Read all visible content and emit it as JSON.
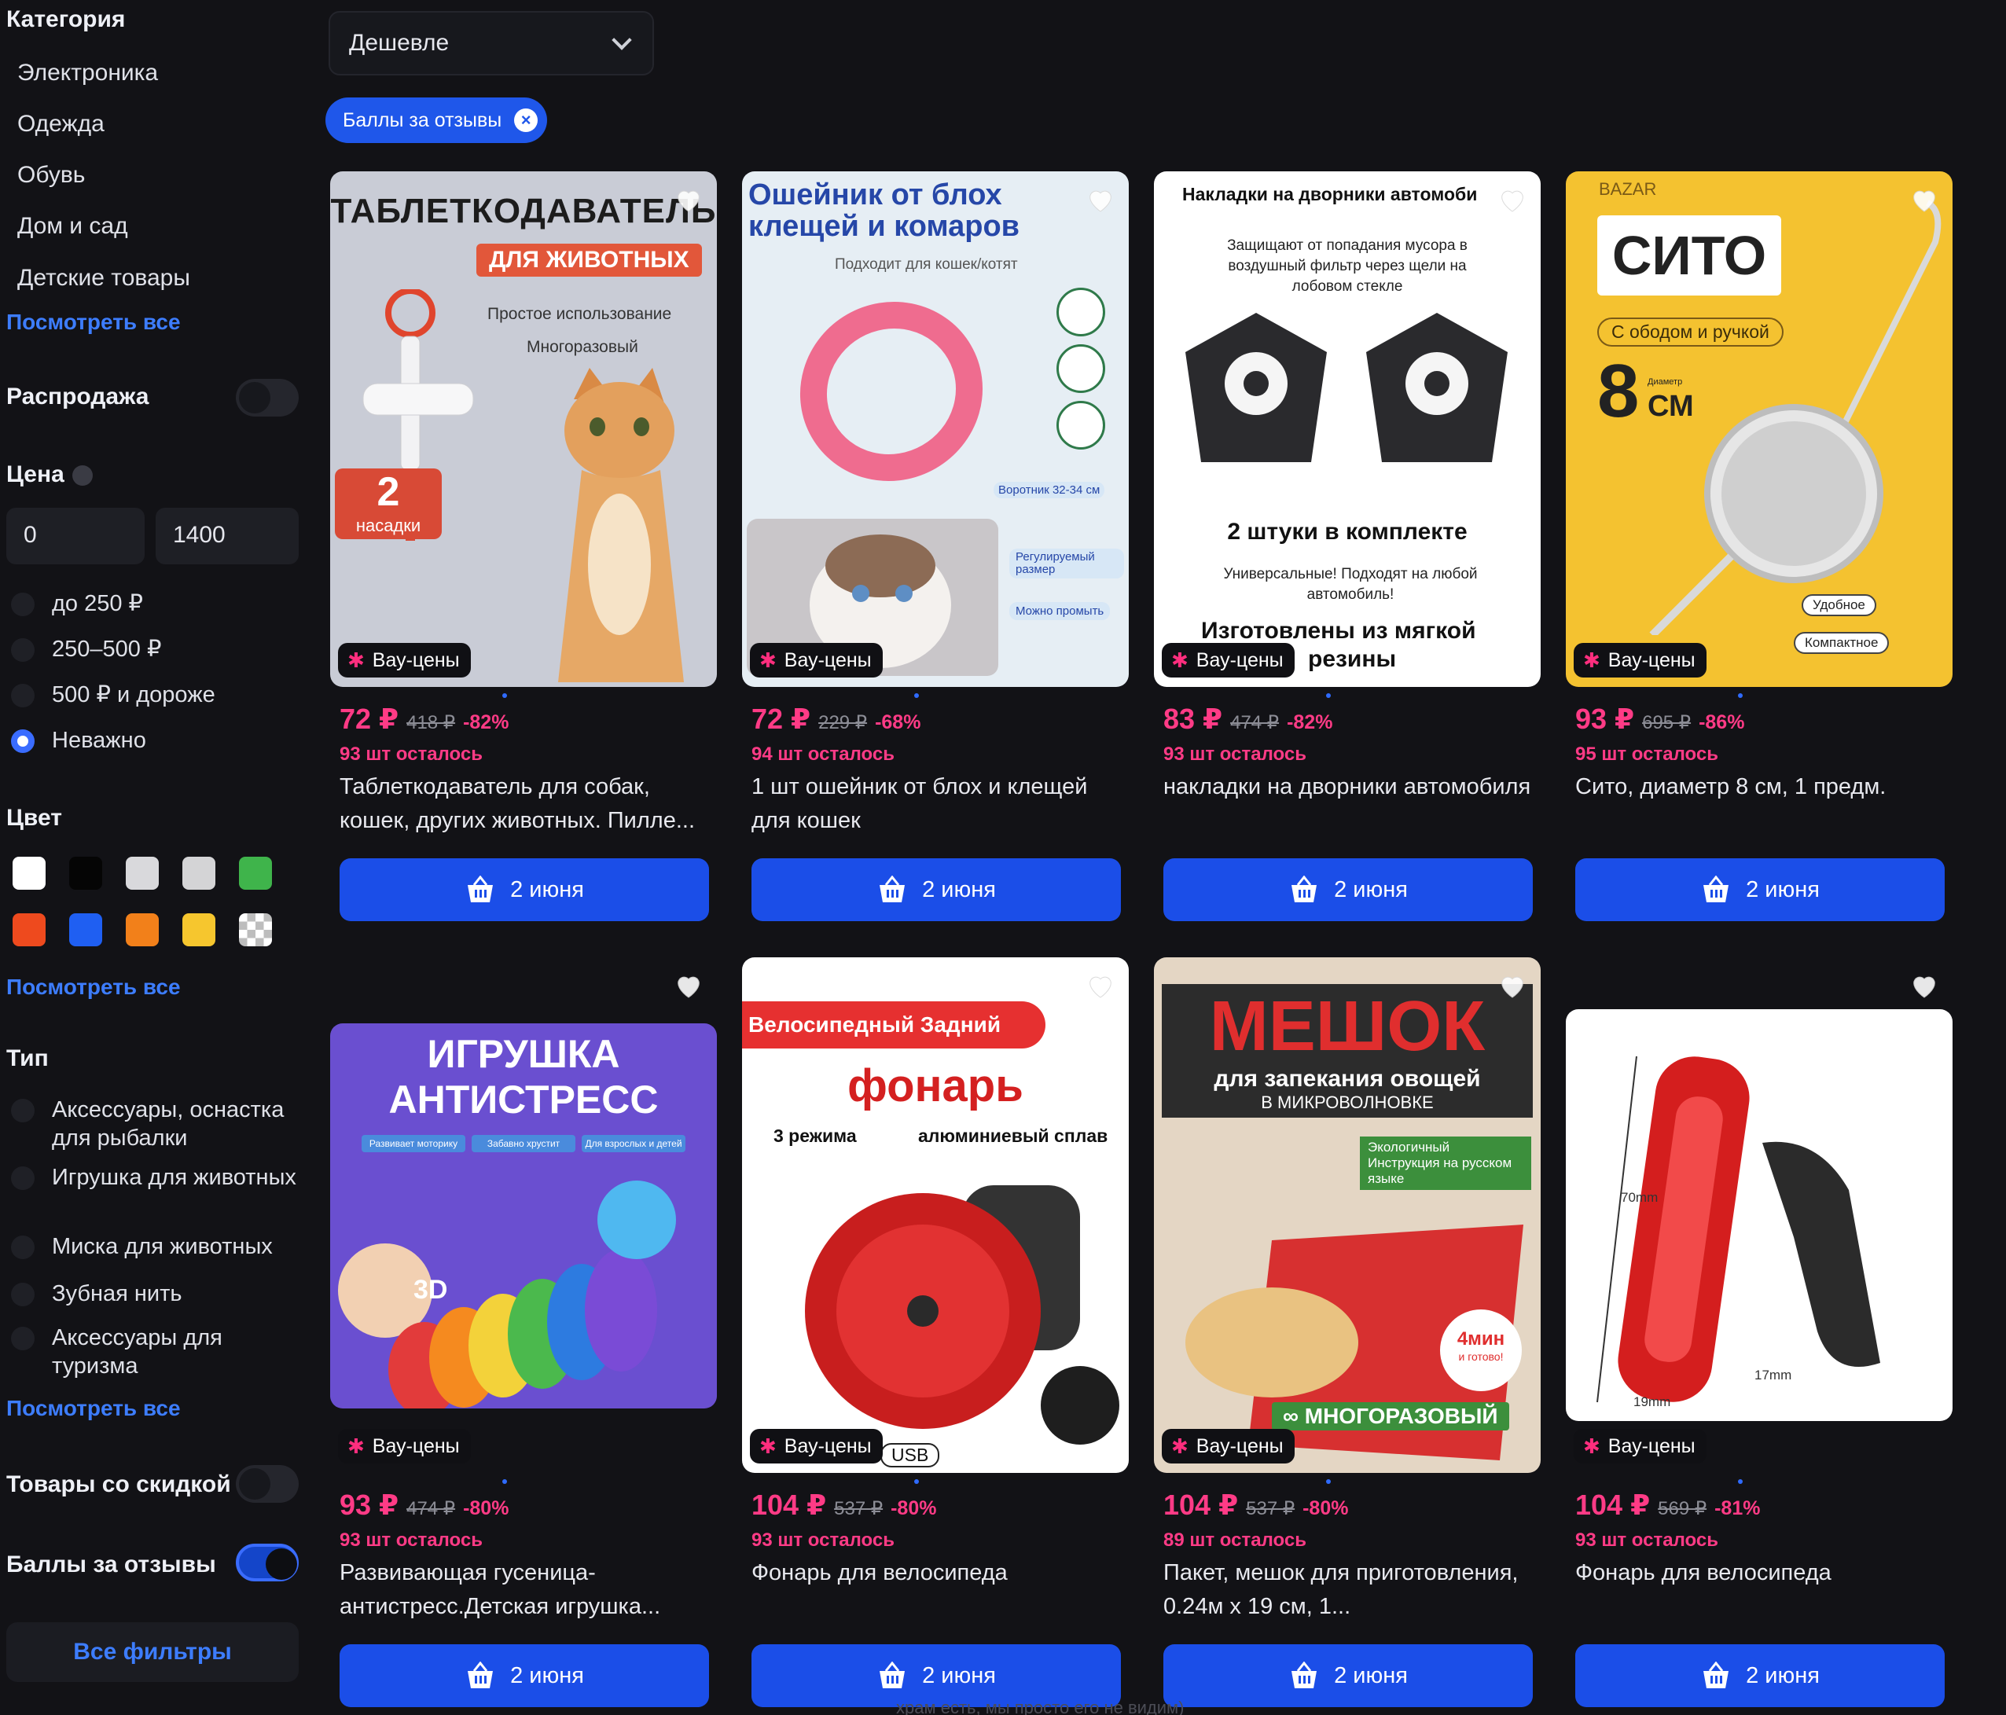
{
  "sidebar": {
    "category_title": "Категория",
    "categories": [
      "Электроника",
      "Одежда",
      "Обувь",
      "Дом и сад",
      "Детские товары"
    ],
    "see_all": "Посмотреть все",
    "sale_label": "Распродажа",
    "price_title": "Цена",
    "price_from": "0",
    "price_to": "1400",
    "price_options": [
      "до 250 ₽",
      "250–500 ₽",
      "500 ₽ и дороже",
      "Неважно"
    ],
    "color_title": "Цвет",
    "colors": [
      "#ffffff",
      "#050505",
      "#d9d9dc",
      "#d4d4d6",
      "#3fb44b",
      "#ee4a1e",
      "#1f5ff2",
      "#f2801a",
      "#f6c62e",
      "checker"
    ],
    "type_title": "Тип",
    "types": [
      "Аксессуары, оснастка для рыбалки",
      "Игрушка для животных",
      "Миска для животных",
      "Зубная нить",
      "Аксессуары для туризма"
    ],
    "discount_label": "Товары со скидкой",
    "review_points_label": "Баллы за отзывы",
    "all_filters": "Все фильтры"
  },
  "sort": {
    "value": "Дешевле"
  },
  "active_filter_chip": "Баллы за отзывы",
  "products": [
    {
      "badge": "Вау-цены",
      "price": "72 ₽",
      "old_price": "418 ₽",
      "discount": "-82%",
      "left": "93 шт осталось",
      "title": "Таблеткодаватель для собак, кошек, других животных. Пилле...",
      "button": "2 июня",
      "img": {
        "bg": "#c9ccd6",
        "h1": "ТАБЛЕТКОДАВАТЕЛЬ",
        "h2": "ДЛЯ ЖИВОТНЫХ",
        "b1": "Простое использование",
        "b2": "Многоразовый",
        "big": "2",
        "small": "насадки"
      }
    },
    {
      "badge": "Вау-цены",
      "price": "72 ₽",
      "old_price": "229 ₽",
      "discount": "-68%",
      "left": "94 шт осталось",
      "title": "1 шт ошейник от блох и клещей для кошек",
      "button": "2 июня",
      "img": {
        "bg": "#e6eef4",
        "h1": "Ошейник от блох",
        "h2": "клещей и комаров",
        "sub": "Подходит для кошек/котят",
        "s1": "Воротник 32-34 см",
        "s2": "Регулируемый размер",
        "s3": "Можно промыть"
      }
    },
    {
      "badge": "Вау-цены",
      "price": "83 ₽",
      "old_price": "474 ₽",
      "discount": "-82%",
      "left": "93 шт осталось",
      "title": "накладки на дворники автомобиля",
      "button": "2 июня",
      "img": {
        "bg": "#ffffff",
        "h1": "Накладки на дворники автомоби",
        "sub": "Защищают от попадания мусора в воздушный фильтр через щели на лобовом стекле",
        "mid": "2 штуки в комплекте",
        "low": "Универсальные! Подходят на любой автомобиль!",
        "bottom1": "Изготовлены из мягкой",
        "bottom2": "резины"
      }
    },
    {
      "badge": "Вау-цены",
      "price": "93 ₽",
      "old_price": "695 ₽",
      "discount": "-86%",
      "left": "95 шт осталось",
      "title": "Сито, диаметр 8 см, 1 предм.",
      "button": "2 июня",
      "img": {
        "bg": "#f4c230",
        "brand": "BAZAR",
        "h1": "СИТО",
        "sub": "С ободом и ручкой",
        "big": "8",
        "unit": "СМ",
        "dia": "Диаметр",
        "s1": "Удобное",
        "s2": "Компактное"
      }
    },
    {
      "badge": "Вау-цены",
      "price": "93 ₽",
      "old_price": "474 ₽",
      "discount": "-80%",
      "left": "93 шт осталось",
      "title": "Развивающая гусеница-антистресс.Детская игрушка...",
      "button": "2 июня",
      "img": {
        "bg": "#6a4fd0",
        "h1": "ИГРУШКА",
        "h2": "АНТИСТРЕСС",
        "t1": "Развивает моторику",
        "t2": "Забавно хрустит",
        "t3": "Для взрослых и детей",
        "tag": "3D"
      }
    },
    {
      "badge": "Вау-цены",
      "price": "104 ₽",
      "old_price": "537 ₽",
      "discount": "-80%",
      "left": "93 шт осталось",
      "title": "Фонарь для велосипеда",
      "button": "2 июня",
      "img": {
        "bg": "#ffffff",
        "h1": "Велосипедный Задний",
        "h2": "фонарь",
        "m1": "3 режима",
        "m2": "алюминиевый сплав",
        "usb": "USB"
      }
    },
    {
      "badge": "Вау-цены",
      "price": "104 ₽",
      "old_price": "537 ₽",
      "discount": "-80%",
      "left": "89 шт осталось",
      "title": "Пакет, мешок для приготовления, 0.24м x 19 см, 1...",
      "button": "2 июня",
      "img": {
        "bg": "#e4d6c4",
        "h1": "МЕШОК",
        "h2": "для запекания овощей",
        "h3": "В МИКРОВОЛНОВКЕ",
        "g1": "Экологичный",
        "g2": "Инструкция на русском языке",
        "timer1": "4мин",
        "timer2": "и готово!",
        "foot": "МНОГОРАЗОВЫЙ"
      }
    },
    {
      "badge": "Вау-цены",
      "price": "104 ₽",
      "old_price": "569 ₽",
      "discount": "-81%",
      "left": "93 шт осталось",
      "title": "Фонарь для велосипеда",
      "button": "2 июня",
      "img": {
        "bg": "#ffffff",
        "d1": "70mm",
        "d2": "17mm",
        "d3": "19mm"
      }
    }
  ],
  "footer_hint": "храм есть, мы просто его не видим)"
}
